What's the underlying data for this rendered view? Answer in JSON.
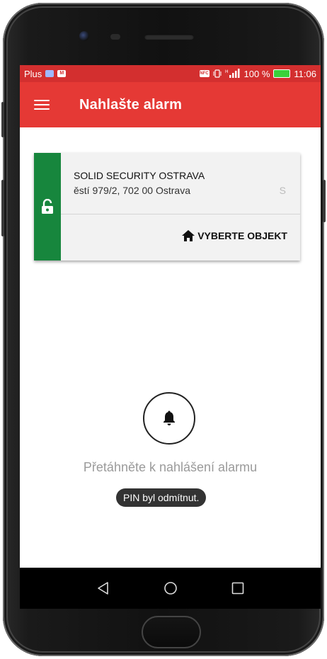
{
  "statusbar": {
    "carrier": "Plus",
    "carrier_icon": "gallery-icon",
    "news_icon": "news-icon",
    "nfc_label": "NFC",
    "signal": "signal-icon",
    "battery_percent": "100 %",
    "time": "11:06"
  },
  "appbar": {
    "title": "Nahlašte alarm",
    "menu_icon": "hamburger-menu-icon"
  },
  "card": {
    "name": "SOLID SECURITY OSTRAVA",
    "address": "ěstí 979/2, 702 00 Ostrava",
    "address_overflow": "S",
    "action_label": "VYBERTE OBJEKT",
    "status": "unlocked",
    "status_color": "#17863d"
  },
  "alarm": {
    "hint": "Přetáhněte k nahlášení alarmu"
  },
  "toast": {
    "message": "PIN byl odmítnut."
  },
  "colors": {
    "appbar": "#e53935",
    "statusbar": "#d32f2f"
  }
}
